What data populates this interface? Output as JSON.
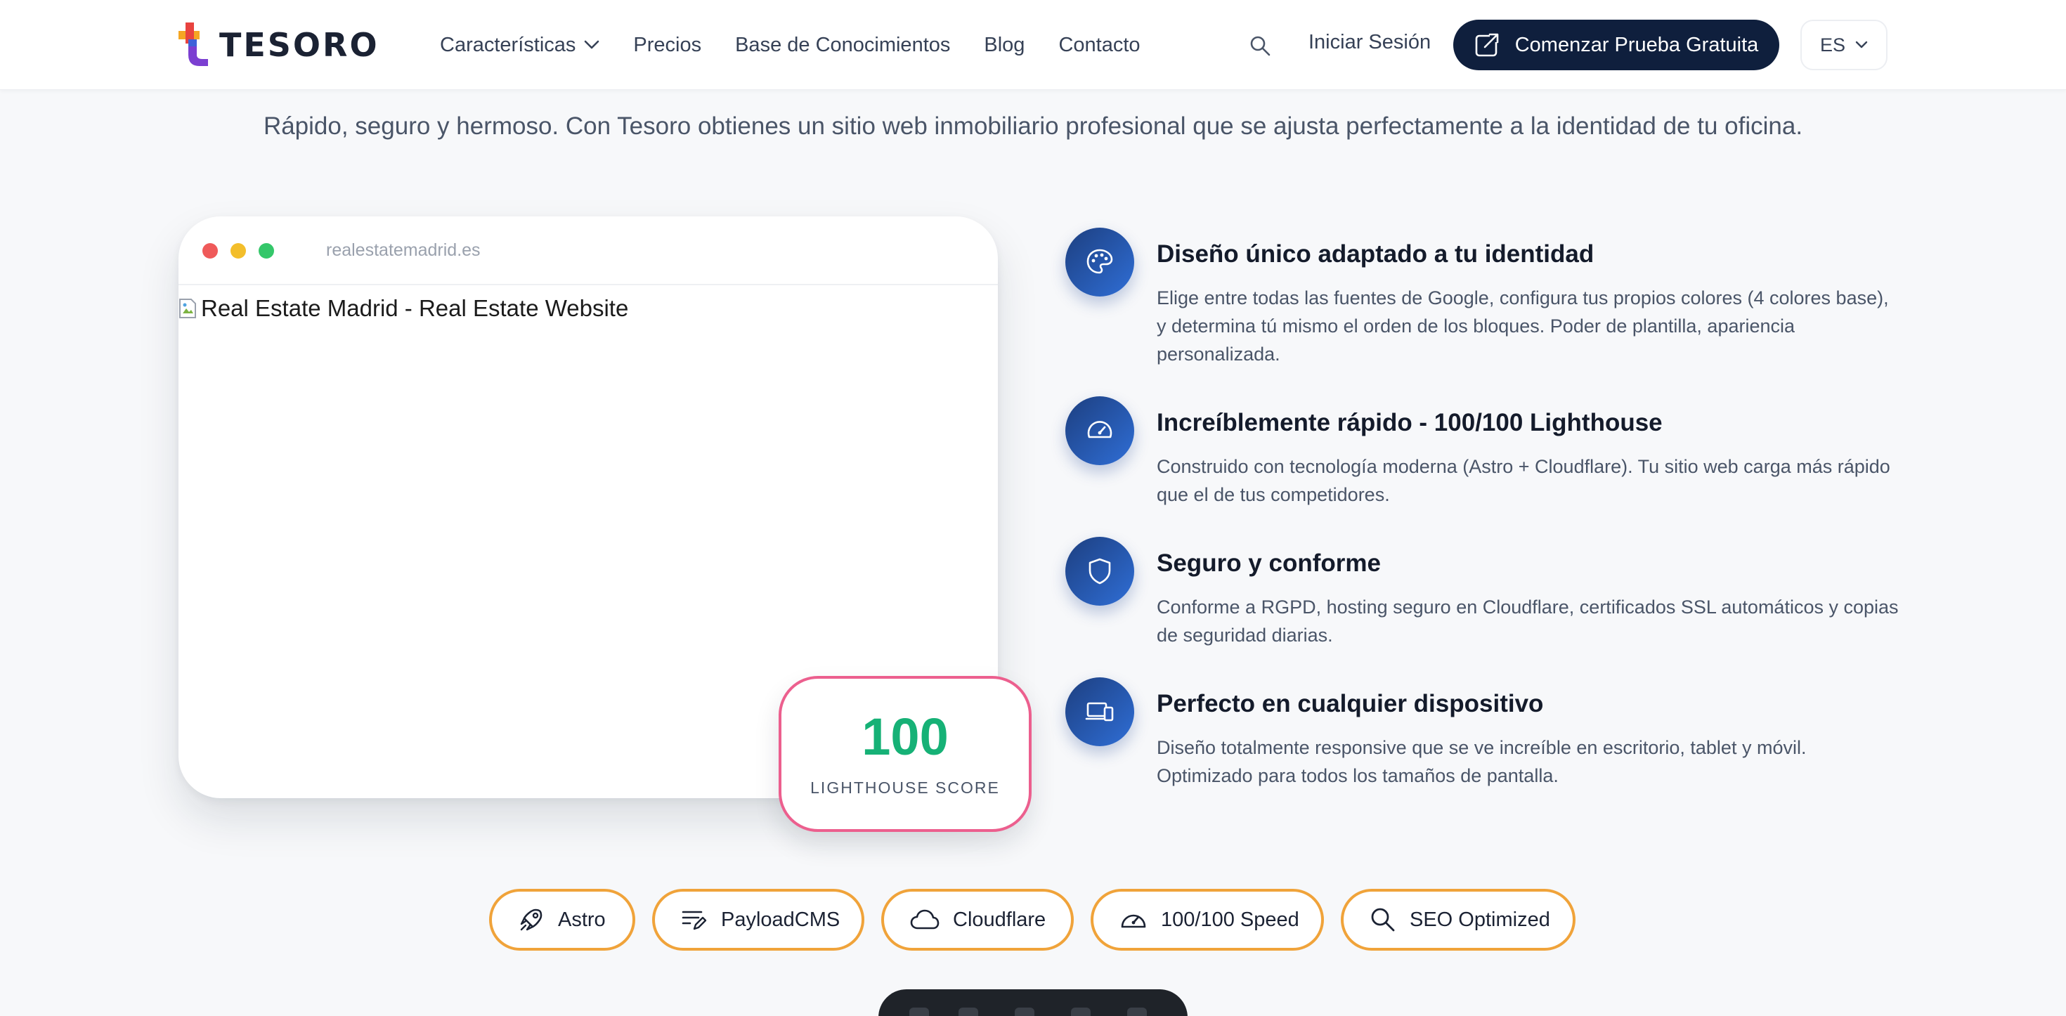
{
  "brand": {
    "name": "TESORO",
    "colors": {
      "primary": "#0f1f3d",
      "accent_gradient": [
        "#1d3f80",
        "#2f6ed6"
      ],
      "score_green": "#16b176",
      "score_border": "#ec5f8e",
      "badge_border": "#f0a33a"
    }
  },
  "nav": {
    "links": [
      "Características",
      "Precios",
      "Base de Conocimientos",
      "Blog",
      "Contacto"
    ],
    "login": "Iniciar Sesión",
    "cta": "Comenzar Prueba Gratuita",
    "language": "ES",
    "icons": {
      "search": "search-icon",
      "cta": "external-link-icon",
      "dropdown": "chevron-down-icon"
    }
  },
  "hero": {
    "subtitle": "Rápido, seguro y hermoso. Con Tesoro obtienes un sitio web inmobiliario profesional que se ajusta perfectamente a la identidad de tu oficina."
  },
  "browser_mock": {
    "url": "realestatemadrid.es",
    "image_alt": "Real Estate Madrid - Real Estate Website"
  },
  "score": {
    "value": "100",
    "label": "LIGHTHOUSE SCORE"
  },
  "features": [
    {
      "icon": "palette-icon",
      "title": "Diseño único adaptado a tu identidad",
      "description": "Elige entre todas las fuentes de Google, configura tus propios colores (4 colores base), y determina tú mismo el orden de los bloques. Poder de plantilla, apariencia personalizada."
    },
    {
      "icon": "speedometer-icon",
      "title": "Increíblemente rápido - 100/100 Lighthouse",
      "description": "Construido con tecnología moderna (Astro + Cloudflare). Tu sitio web carga más rápido que el de tus competidores."
    },
    {
      "icon": "shield-icon",
      "title": "Seguro y conforme",
      "description": "Conforme a RGPD, hosting seguro en Cloudflare, certificados SSL automáticos y copias de seguridad diarias."
    },
    {
      "icon": "devices-icon",
      "title": "Perfecto en cualquier dispositivo",
      "description": "Diseño totalmente responsive que se ve increíble en escritorio, tablet y móvil. Optimizado para todos los tamaños de pantalla."
    }
  ],
  "tech_badges": [
    {
      "icon": "rocket-icon",
      "label": "Astro"
    },
    {
      "icon": "edit-lines-icon",
      "label": "PayloadCMS"
    },
    {
      "icon": "cloud-icon",
      "label": "Cloudflare"
    },
    {
      "icon": "speedometer-icon",
      "label": "100/100 Speed"
    },
    {
      "icon": "search-icon",
      "label": "SEO Optimized"
    }
  ]
}
